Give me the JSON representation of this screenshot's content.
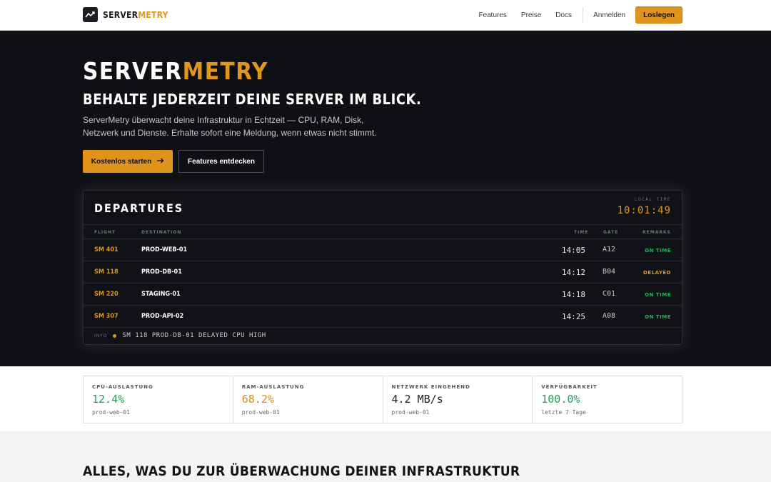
{
  "nav": {
    "logo_main": "SERVER",
    "logo_accent": "METRY",
    "links": [
      "Features",
      "Preise",
      "Docs"
    ],
    "login": "Anmelden",
    "cta": "Loslegen"
  },
  "hero": {
    "title_main": "SERVER",
    "title_accent": "METRY",
    "subtitle": "BEHALTE JEDERZEIT DEINE SERVER IM BLICK.",
    "description": "ServerMetry überwacht deine Infrastruktur in Echtzeit — CPU, RAM, Disk, Netzwerk und Dienste. Erhalte sofort eine Meldung, wenn etwas nicht stimmt.",
    "primary_button": "Kostenlos starten",
    "secondary_button": "Features entdecken"
  },
  "board": {
    "title": "DEPARTURES",
    "local_time_label": "LOCAL TIME",
    "local_time": "10:01:49",
    "columns": {
      "flight": "FLIGHT",
      "destination": "DESTINATION",
      "time": "TIME",
      "gate": "GATE",
      "remarks": "REMARKS"
    },
    "rows": [
      {
        "flight": "SM 401",
        "destination": "PROD-WEB-01",
        "time": "14:05",
        "gate": "A12",
        "remark": "ON TIME",
        "status": "ok"
      },
      {
        "flight": "SM 118",
        "destination": "PROD-DB-01",
        "time": "14:12",
        "gate": "B04",
        "remark": "DELAYED",
        "status": "delay"
      },
      {
        "flight": "SM 220",
        "destination": "STAGING-01",
        "time": "14:18",
        "gate": "C01",
        "remark": "ON TIME",
        "status": "ok"
      },
      {
        "flight": "SM 307",
        "destination": "PROD-API-02",
        "time": "14:25",
        "gate": "A08",
        "remark": "ON TIME",
        "status": "ok"
      }
    ],
    "ticker_label": "INFO",
    "ticker_text": "SM 118 PROD-DB-01 DELAYED CPU HIGH"
  },
  "stats": [
    {
      "label": "CPU-AUSLASTUNG",
      "value": "12.4%",
      "sub": "prod-web-01",
      "color": "#1f9d57"
    },
    {
      "label": "RAM-AUSLASTUNG",
      "value": "68.2%",
      "sub": "prod-web-01",
      "color": "#d98c12"
    },
    {
      "label": "NETZWERK EINGEHEND",
      "value": "4.2 MB/s",
      "sub": "prod-web-01",
      "color": "#222222"
    },
    {
      "label": "VERFÜGBARKEIT",
      "value": "100.0%",
      "sub": "letzte 7 Tage",
      "color": "#1f9d57"
    }
  ],
  "features": {
    "title": "ALLES, WAS DU ZUR ÜBERWACHUNG DEINER INFRASTRUKTUR"
  },
  "colors": {
    "accent": "#e0941c",
    "ok": "#22b35e",
    "hero_bg": "#0e1014"
  },
  "icons": {
    "logo": "chart-trend-icon",
    "button_arrow": "arrow-right-icon"
  }
}
